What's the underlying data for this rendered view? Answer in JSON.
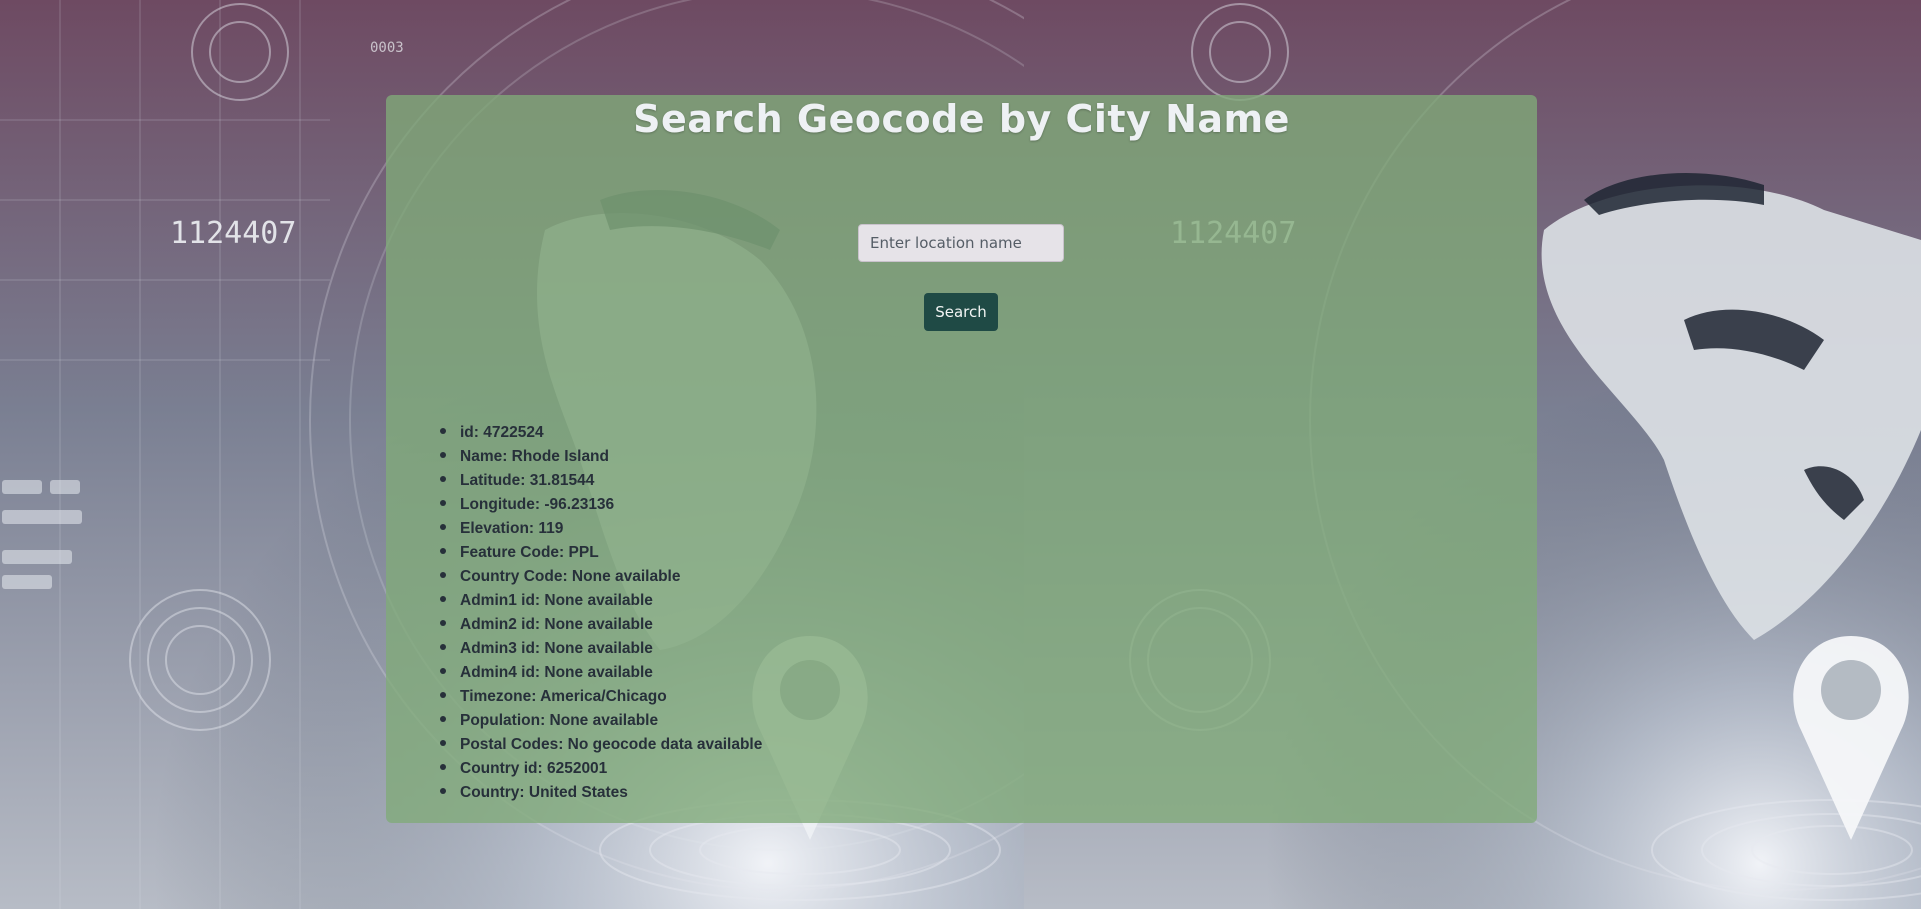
{
  "page": {
    "title": "Search Geocode by City Name"
  },
  "search": {
    "placeholder": "Enter location name",
    "value": "",
    "button_label": "Search"
  },
  "result": {
    "items": [
      "id: 4722524",
      "Name: Rhode Island",
      "Latitude: 31.81544",
      "Longitude: -96.23136",
      "Elevation: 119",
      "Feature Code: PPL",
      "Country Code: None available",
      "Admin1 id: None available",
      "Admin2 id: None available",
      "Admin3 id: None available",
      "Admin4 id: None available",
      "Timezone: America/Chicago",
      "Population: None available",
      "Postal Codes: No geocode data available",
      "Country id: 6252001",
      "Country: United States"
    ]
  },
  "background": {
    "numeric_label": "1124407",
    "small_label": "0003"
  },
  "colors": {
    "panel": "#80aa78",
    "button": "#1f4a45",
    "title": "#eef1f4",
    "text": "#27303a"
  }
}
